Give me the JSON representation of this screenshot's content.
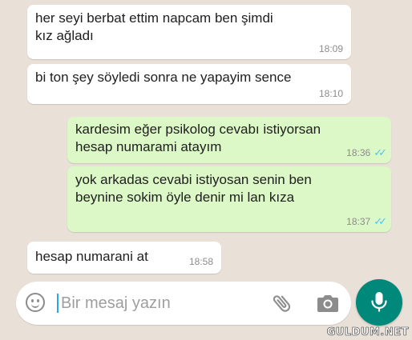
{
  "messages": [
    {
      "text": "her seyi berbat ettim napcam ben şimdi\nkız ağladı",
      "time": "18:09",
      "direction": "incoming"
    },
    {
      "text": "bi ton şey söyledi sonra ne yapayim sence",
      "time": "18:10",
      "direction": "incoming"
    },
    {
      "text": "kardesim eğer psikolog cevabı istiyorsan\nhesap numarami atayım",
      "time": "18:36",
      "direction": "outgoing",
      "status": "read"
    },
    {
      "text": "yok arkadas cevabi istiyosan senin ben\nbeynine sokim öyle denir mi lan kıza",
      "time": "18:37",
      "direction": "outgoing",
      "status": "read"
    },
    {
      "text": "hesap numarani at",
      "time": "18:58",
      "direction": "incoming"
    }
  ],
  "composer": {
    "placeholder": "Bir mesaj yazın",
    "icons": [
      "emoji-icon",
      "attach-icon",
      "camera-icon",
      "mic-icon"
    ]
  },
  "watermark": "GULDUM.NET",
  "colors": {
    "background": "#e9e1d8",
    "incoming_bubble": "#ffffff",
    "outgoing_bubble": "#dcf8c6",
    "read_ticks": "#4fc3f7",
    "mic_button": "#00897b"
  }
}
